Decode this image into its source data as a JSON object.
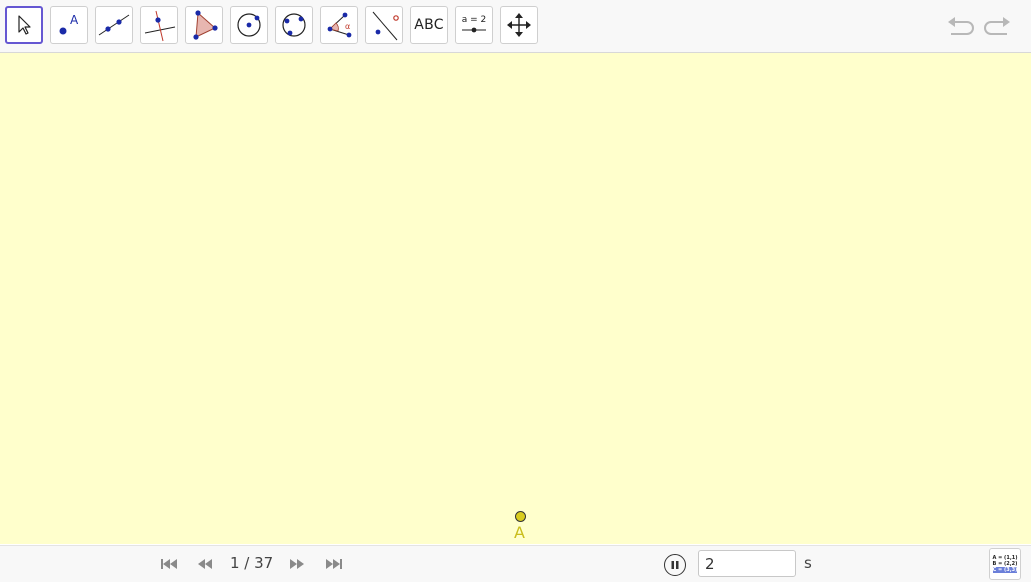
{
  "toolbar": {
    "tools": [
      {
        "name": "move-tool"
      },
      {
        "name": "point-tool",
        "label": "A"
      },
      {
        "name": "line-tool"
      },
      {
        "name": "perpendicular-line-tool"
      },
      {
        "name": "polygon-tool"
      },
      {
        "name": "circle-tool"
      },
      {
        "name": "circle-three-points-tool"
      },
      {
        "name": "angle-tool",
        "label": "α"
      },
      {
        "name": "reflect-tool"
      },
      {
        "name": "text-tool",
        "label": "ABC"
      },
      {
        "name": "slider-tool",
        "label": "a = 2"
      },
      {
        "name": "move-graphics-view-tool"
      }
    ],
    "active_tool": "move-tool",
    "accent_color": "#6557d2"
  },
  "canvas": {
    "background": "#ffffcc",
    "point": {
      "label": "A",
      "color": "#d9cc1e"
    }
  },
  "footer": {
    "step_current": "1",
    "step_total": "37",
    "step_text": "1 / 37",
    "speed_value": "2",
    "speed_unit": "s",
    "algebra_lines": [
      "A = (1,1)",
      "B = (2,2)",
      "C = (3,3)"
    ]
  }
}
